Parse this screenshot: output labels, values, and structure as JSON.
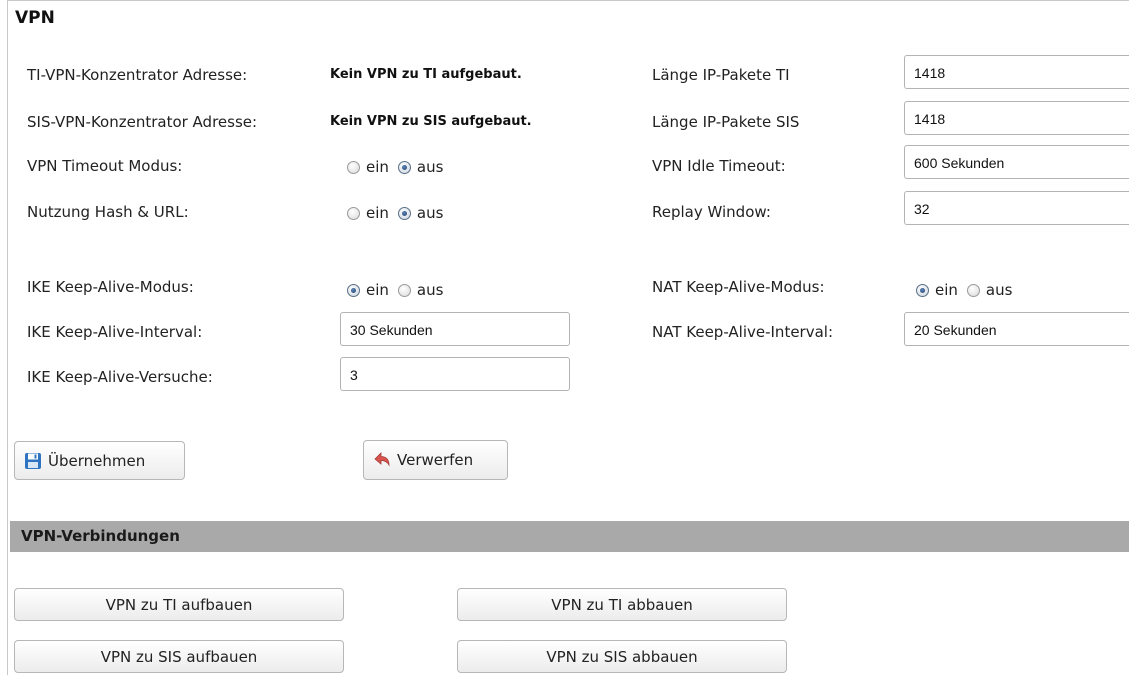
{
  "page_title": "VPN",
  "fields": {
    "ti_concentrator": {
      "label": "TI-VPN-Konzentrator Adresse:",
      "value": "Kein VPN zu TI aufgebaut."
    },
    "sis_concentrator": {
      "label": "SIS-VPN-Konzentrator Adresse:",
      "value": "Kein VPN zu SIS aufgebaut."
    },
    "timeout_mode": {
      "label": "VPN Timeout Modus:",
      "options": [
        "ein",
        "aus"
      ],
      "selected": "aus"
    },
    "hash_url": {
      "label": "Nutzung Hash & URL:",
      "options": [
        "ein",
        "aus"
      ],
      "selected": "aus"
    },
    "ike_mode": {
      "label": "IKE Keep-Alive-Modus:",
      "options": [
        "ein",
        "aus"
      ],
      "selected": "ein"
    },
    "ike_interval": {
      "label": "IKE Keep-Alive-Interval:",
      "value": "30 Sekunden"
    },
    "ike_attempts": {
      "label": "IKE Keep-Alive-Versuche:",
      "value": "3"
    },
    "ti_packet_len": {
      "label": "Länge IP-Pakete TI",
      "value": "1418"
    },
    "sis_packet_len": {
      "label": "Länge IP-Pakete SIS",
      "value": "1418"
    },
    "idle_timeout": {
      "label": "VPN Idle Timeout:",
      "value": "600 Sekunden"
    },
    "replay_window": {
      "label": "Replay Window:",
      "value": "32"
    },
    "nat_mode": {
      "label": "NAT Keep-Alive-Modus:",
      "options": [
        "ein",
        "aus"
      ],
      "selected": "ein"
    },
    "nat_interval": {
      "label": "NAT Keep-Alive-Interval:",
      "value": "20 Sekunden"
    }
  },
  "actions": {
    "apply": "Übernehmen",
    "discard": "Verwerfen"
  },
  "connections": {
    "title": "VPN-Verbindungen",
    "ti_up": "VPN zu TI aufbauen",
    "ti_down": "VPN zu TI abbauen",
    "sis_up": "VPN zu SIS aufbauen",
    "sis_down": "VPN zu SIS abbauen"
  },
  "icons": {
    "apply": "save-disk-icon",
    "discard": "undo-arrow-icon"
  },
  "colors": {
    "section_bar": "#a9a9a9",
    "radio_selected": "#1f3f6b",
    "border": "#b3b3b3"
  }
}
